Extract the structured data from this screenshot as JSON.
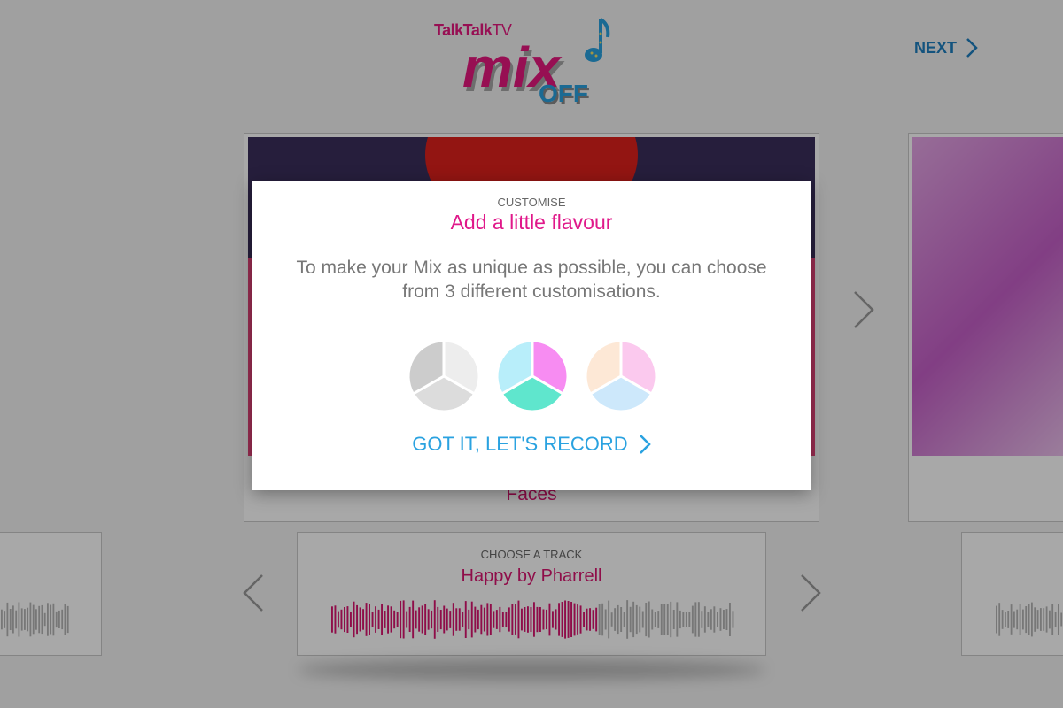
{
  "header": {
    "logo_brand": "TalkTalk",
    "logo_brand_tv": "TV",
    "logo_mix": "mix",
    "logo_off": "OFF",
    "next_label": "NEXT"
  },
  "video_carousel": {
    "current_title": "Faces"
  },
  "track_chooser": {
    "label": "CHOOSE A TRACK",
    "track_name": "Happy by Pharrell",
    "progress": 0.66
  },
  "modal": {
    "kicker": "CUSTOMISE",
    "title": "Add a little flavour",
    "body": "To make your Mix as unique as possible, you can choose from 3 different customisations.",
    "swatches": [
      {
        "name": "grey",
        "colors": [
          "#ededed",
          "#dcdcdc",
          "#cccccc"
        ]
      },
      {
        "name": "aqua-pink",
        "colors": [
          "#f78cf2",
          "#5fe6cd",
          "#b8eefa"
        ]
      },
      {
        "name": "pastel",
        "colors": [
          "#fbc9ee",
          "#cde8fb",
          "#fde8d6"
        ]
      }
    ],
    "cta_label": "GOT IT, LET'S RECORD"
  },
  "colors": {
    "accent_pink": "#e0188a",
    "accent_blue": "#2aa2e0",
    "wave_played": "#d9146f",
    "wave_unplayed": "#b5b5b5"
  }
}
